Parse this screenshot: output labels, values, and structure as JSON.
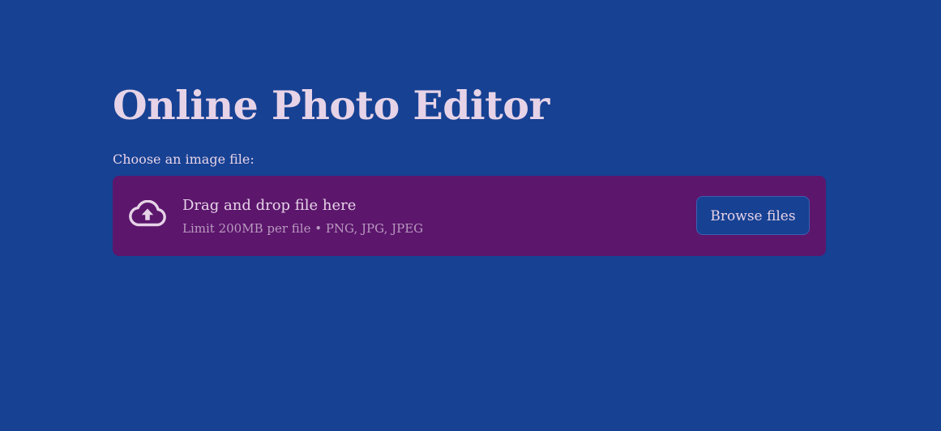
{
  "page": {
    "title": "Online Photo Editor",
    "background_color": "#174193"
  },
  "uploader": {
    "label": "Choose an image file:",
    "dropzone": {
      "title": "Drag and drop file here",
      "limit_text": "Limit 200MB per file • PNG, JPG, JPEG",
      "icon": "cloud-upload-icon",
      "background_color": "#5c166c"
    },
    "browse_button_label": "Browse files"
  },
  "colors": {
    "text": "#e6d3e7",
    "muted_text": "#b999bf"
  }
}
